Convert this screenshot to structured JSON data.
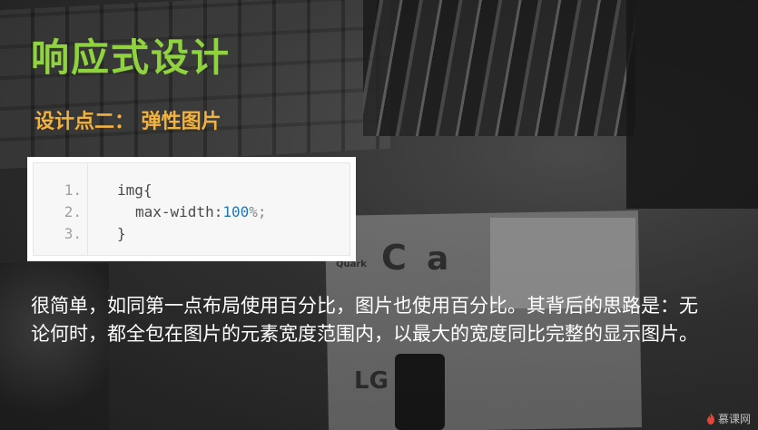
{
  "slide": {
    "title": "响应式设计",
    "subtitle": "设计点二： 弹性图片",
    "colors": {
      "title": "#8fd33f",
      "subtitle": "#f3b23c",
      "body": "#ffffff",
      "code_number": "#1f78b4"
    }
  },
  "code": {
    "line_numbers": [
      "1.",
      "2.",
      "3."
    ],
    "line1": "img{",
    "line2_prop": "max-width:",
    "line2_value": "100",
    "line2_unit": "%;",
    "line3": "}"
  },
  "body": {
    "text": "很简单，如同第一点布局使用百分比，图片也使用百分比。其背后的思路是：无论何时，都全包在图片的元素宽度范围内，以最大的宽度同比完整的显示图片。"
  },
  "background": {
    "logos": [
      "Quark",
      "C",
      "a",
      "LG"
    ]
  },
  "watermark": {
    "icon": "flame-icon",
    "text": "慕课网"
  }
}
